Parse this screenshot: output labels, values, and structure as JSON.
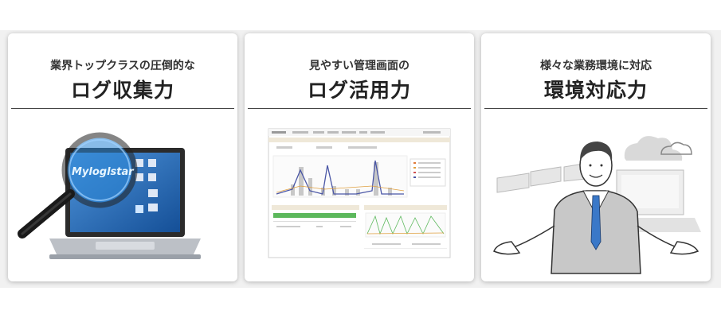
{
  "cards": [
    {
      "subtitle": "業界トップクラスの圧倒的な",
      "title": "ログ収集力",
      "logo_text": "Myloglstar"
    },
    {
      "subtitle": "見やすい管理画面の",
      "title": "ログ活用力"
    },
    {
      "subtitle": "様々な業務環境に対応",
      "title": "環境対応力"
    }
  ],
  "colors": {
    "title_text": "#222222",
    "laptop_screen_blue": "#1e64b4",
    "dashboard_green": "#5cb85c",
    "cloud_gray": "#d9d9d9"
  }
}
